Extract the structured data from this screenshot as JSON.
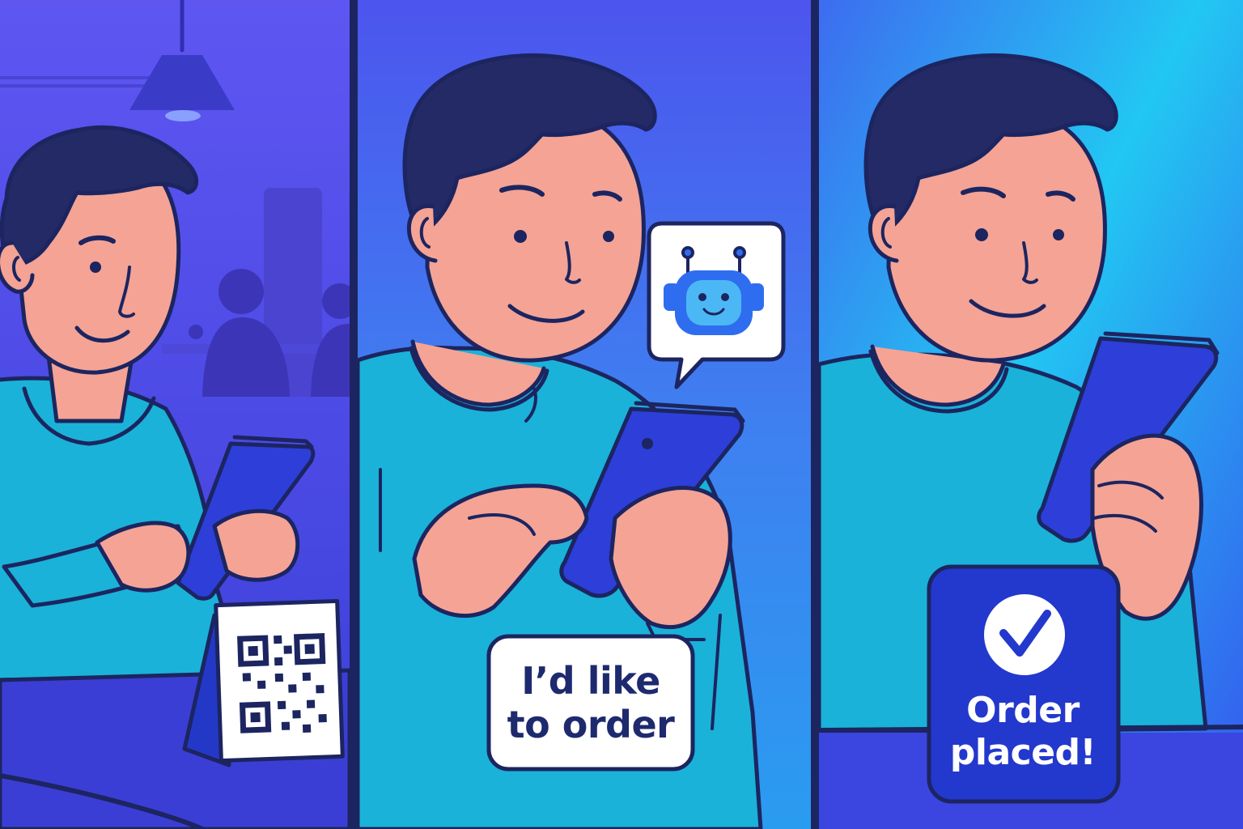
{
  "panels": [
    {
      "id": "scan-qr",
      "speech": ""
    },
    {
      "id": "chat-order",
      "speech": "I’d like\nto order"
    },
    {
      "id": "confirmation",
      "status": "Order placed!"
    }
  ],
  "icons": {
    "table_tent": "qr-code-icon",
    "chat_bubble": "robot-icon",
    "badge": "check-icon"
  },
  "colors": {
    "outline": "#1c2560",
    "panel1_bg": "#5a52ee",
    "panel2_bg": "#4d62f0",
    "panel3_bg": "#2ec3f0",
    "shirt": "#1ab2d8",
    "skin": "#f4a395",
    "hair": "#232a66",
    "phone": "#2d3fd8",
    "badge": "#2338cc",
    "bubble": "#ffffff"
  }
}
